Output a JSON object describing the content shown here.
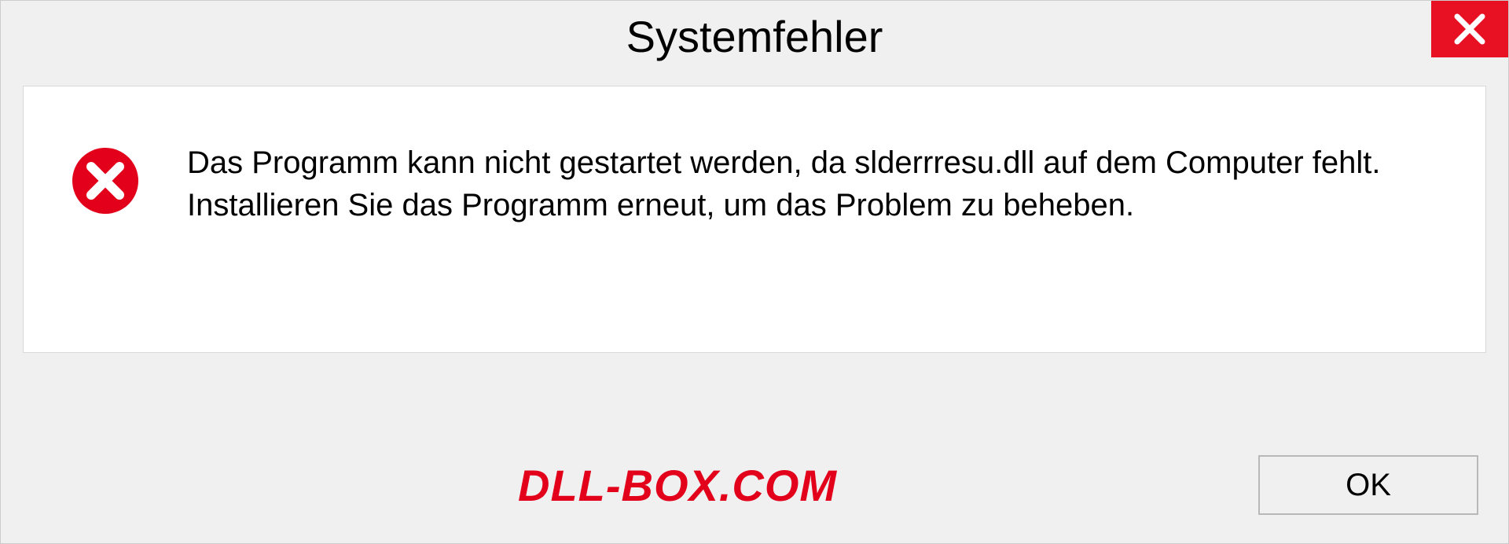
{
  "dialog": {
    "title": "Systemfehler",
    "message": "Das Programm kann nicht gestartet werden, da slderrresu.dll auf dem Computer fehlt. Installieren Sie das Programm erneut, um das Problem zu beheben.",
    "ok_label": "OK"
  },
  "watermark": "DLL-BOX.COM"
}
